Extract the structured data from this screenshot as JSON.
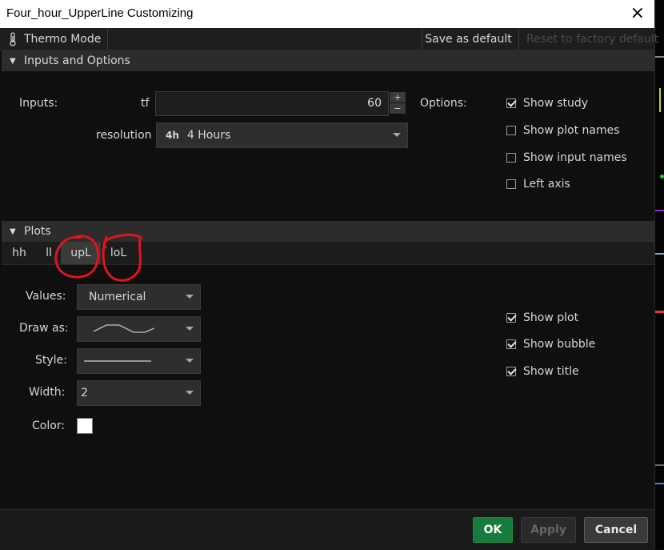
{
  "window": {
    "title": "Four_hour_UpperLine Customizing",
    "close_icon": "×"
  },
  "toolbar": {
    "thermo_mode": "Thermo Mode",
    "save_default": "Save as default",
    "reset_default": "Reset to factory default"
  },
  "inputs_section": {
    "header": "Inputs and Options",
    "inputs_label": "Inputs:",
    "tf_label": "tf",
    "tf_value": "60",
    "resolution_label": "resolution",
    "resolution_code": "4h",
    "resolution_value": "4 Hours",
    "options_label": "Options:",
    "options": [
      {
        "label": "Show study",
        "checked": true
      },
      {
        "label": "Show plot names",
        "checked": false
      },
      {
        "label": "Show input names",
        "checked": false
      },
      {
        "label": "Left axis",
        "checked": false
      }
    ]
  },
  "plots_section": {
    "header": "Plots",
    "tabs": [
      "hh",
      "ll",
      "upL",
      "loL"
    ],
    "active_tab": "upL",
    "values_label": "Values:",
    "values_value": "Numerical",
    "draw_as_label": "Draw as:",
    "style_label": "Style:",
    "width_label": "Width:",
    "width_value": "2",
    "color_label": "Color:",
    "color_value": "#ffffff",
    "checkboxes": [
      {
        "label": "Show plot",
        "checked": true
      },
      {
        "label": "Show bubble",
        "checked": true
      },
      {
        "label": "Show title",
        "checked": true
      }
    ]
  },
  "footer": {
    "ok": "OK",
    "apply": "Apply",
    "cancel": "Cancel"
  },
  "colors": {
    "ok_green": "#167b3c",
    "annotation_red": "#e0141e",
    "panel": "#0f0f0f"
  }
}
